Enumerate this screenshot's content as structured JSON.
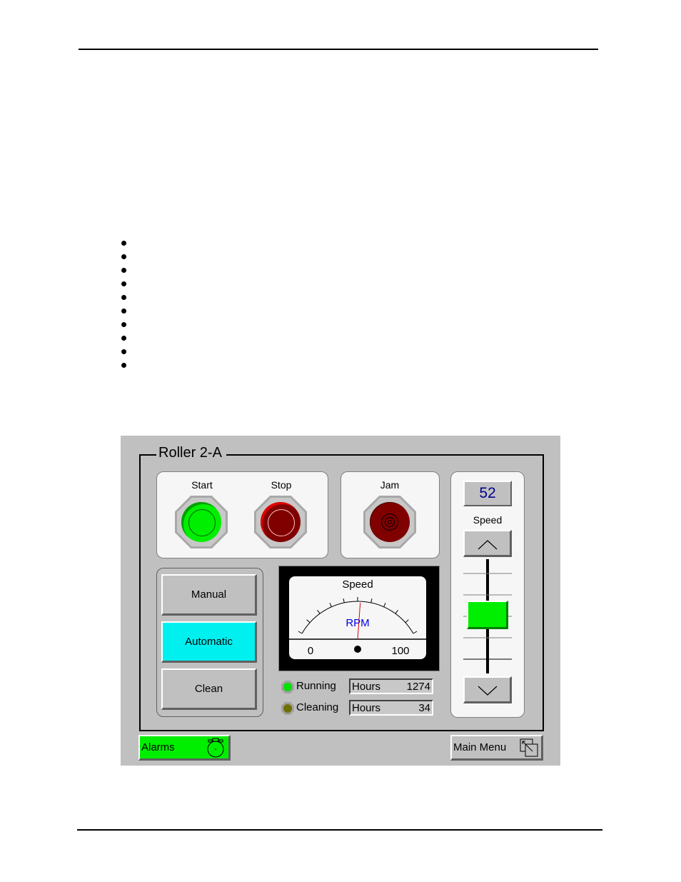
{
  "document": {
    "bullet_count": 10
  },
  "hmi": {
    "title": "Roller 2-A",
    "buttons": {
      "start_label": "Start",
      "stop_label": "Stop",
      "jam_label": "Jam"
    },
    "modes": [
      {
        "label": "Manual",
        "active": false
      },
      {
        "label": "Automatic",
        "active": true
      },
      {
        "label": "Clean",
        "active": false
      }
    ],
    "gauge": {
      "title": "Speed",
      "unit": "RPM",
      "min_label": "0",
      "max_label": "100",
      "value": 52
    },
    "status": [
      {
        "label": "Running",
        "hours_label": "Hours",
        "hours_value": "1274",
        "led_color": "#00e000"
      },
      {
        "label": "Cleaning",
        "hours_label": "Hours",
        "hours_value": "34",
        "led_color": "#707000"
      }
    ],
    "speed_control": {
      "value": "52",
      "label": "Speed",
      "slider_fraction": 0.52
    },
    "footer": {
      "alarms_label": "Alarms",
      "main_menu_label": "Main Menu"
    },
    "colors": {
      "start_green": "#00ee00",
      "stop_red": "#800000",
      "active_mode": "#00f0f0",
      "alarm_green": "#00ee00",
      "value_blue": "#000090"
    }
  }
}
